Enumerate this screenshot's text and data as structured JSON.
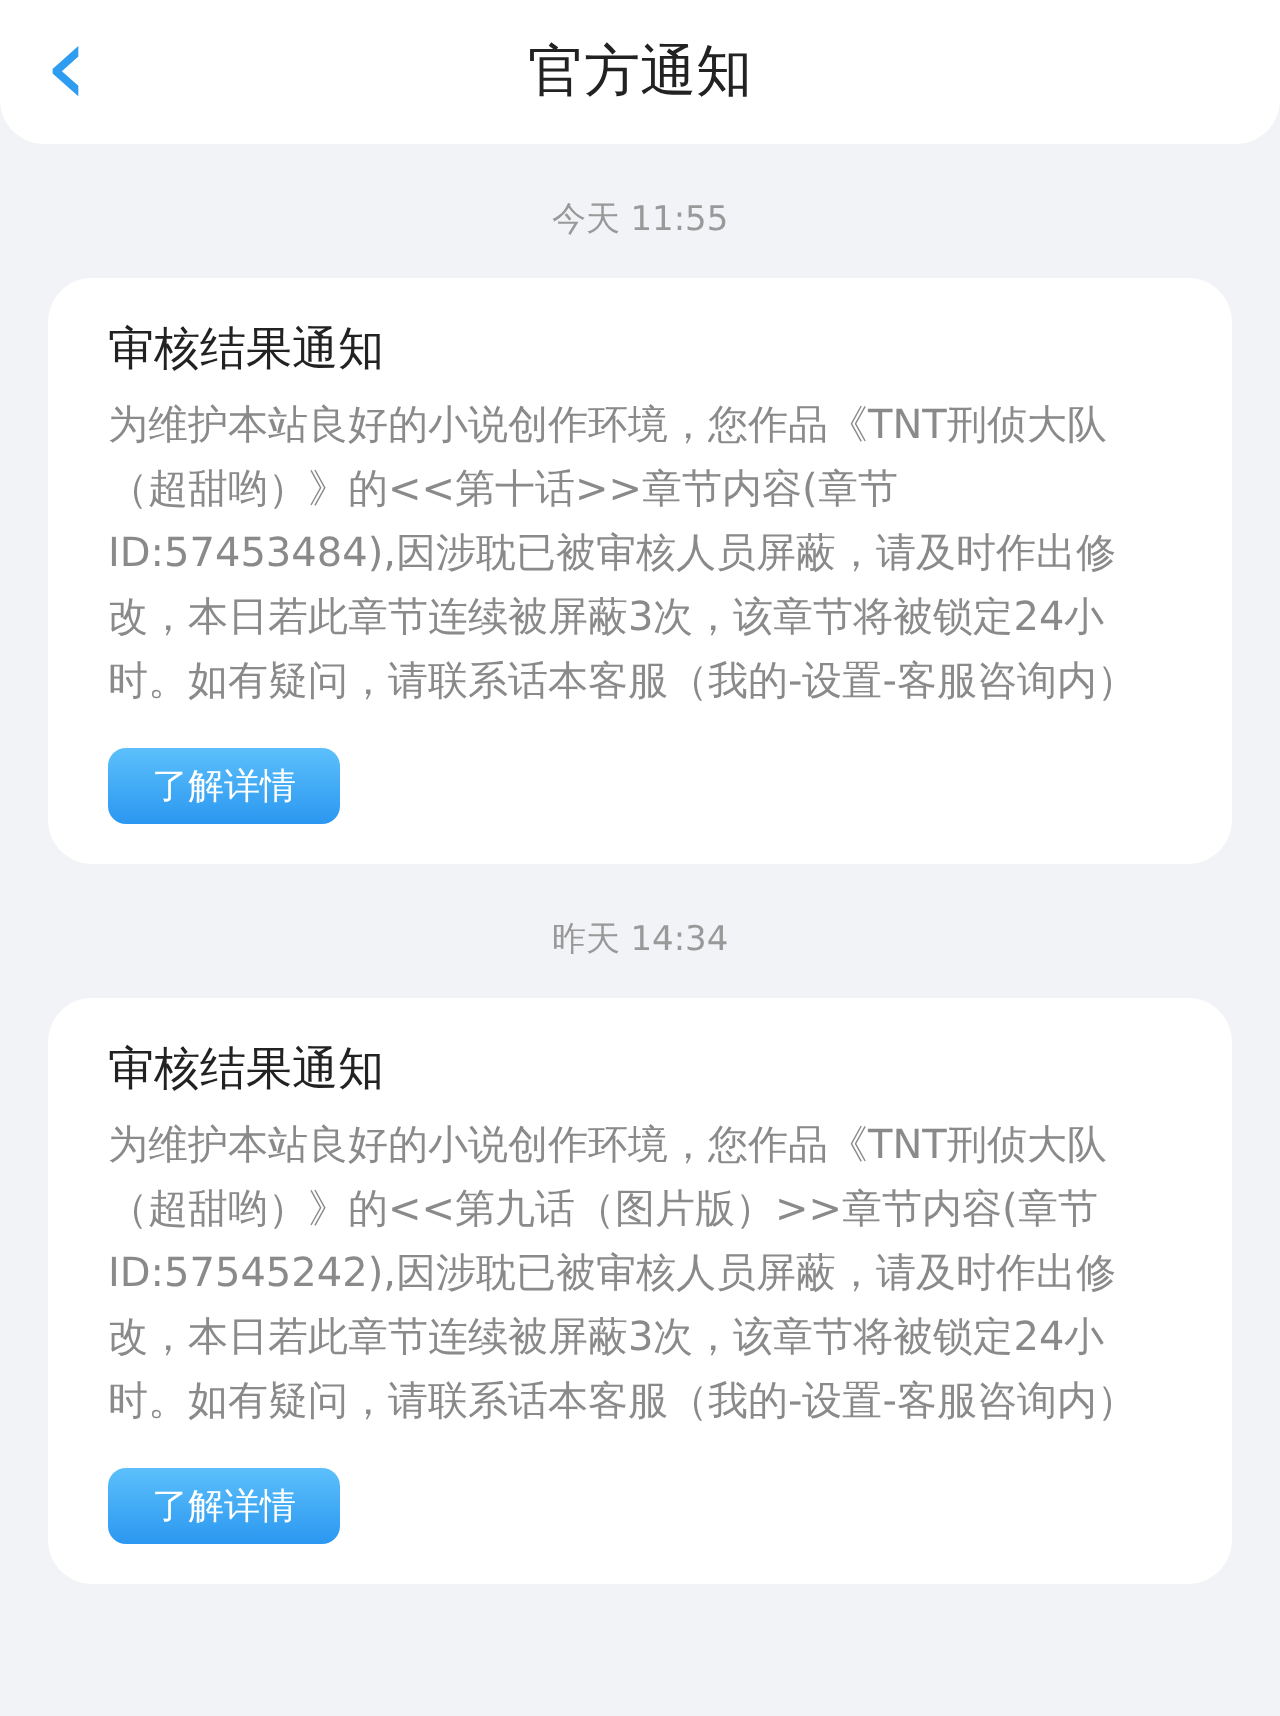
{
  "header": {
    "back": "‹",
    "title": "官方通知"
  },
  "messages": [
    {
      "time": "今天 11:55",
      "title": "审核结果通知",
      "body": "为维护本站良好的小说创作环境，您作品《TNT刑侦大队（超甜哟）》的<<第十话>>章节内容(章节ID:57453484),因涉耽已被审核人员屏蔽，请及时作出修改，本日若此章节连续被屏蔽3次，该章节将被锁定24小时。如有疑问，请联系话本客服（我的-设置-客服咨询内）",
      "button": "了解详情"
    },
    {
      "time": "昨天 14:34",
      "title": "审核结果通知",
      "body": "为维护本站良好的小说创作环境，您作品《TNT刑侦大队（超甜哟）》的<<第九话（图片版）>>章节内容(章节ID:57545242),因涉耽已被审核人员屏蔽，请及时作出修改，本日若此章节连续被屏蔽3次，该章节将被锁定24小时。如有疑问，请联系话本客服（我的-设置-客服咨询内）",
      "button": "了解详情"
    }
  ]
}
